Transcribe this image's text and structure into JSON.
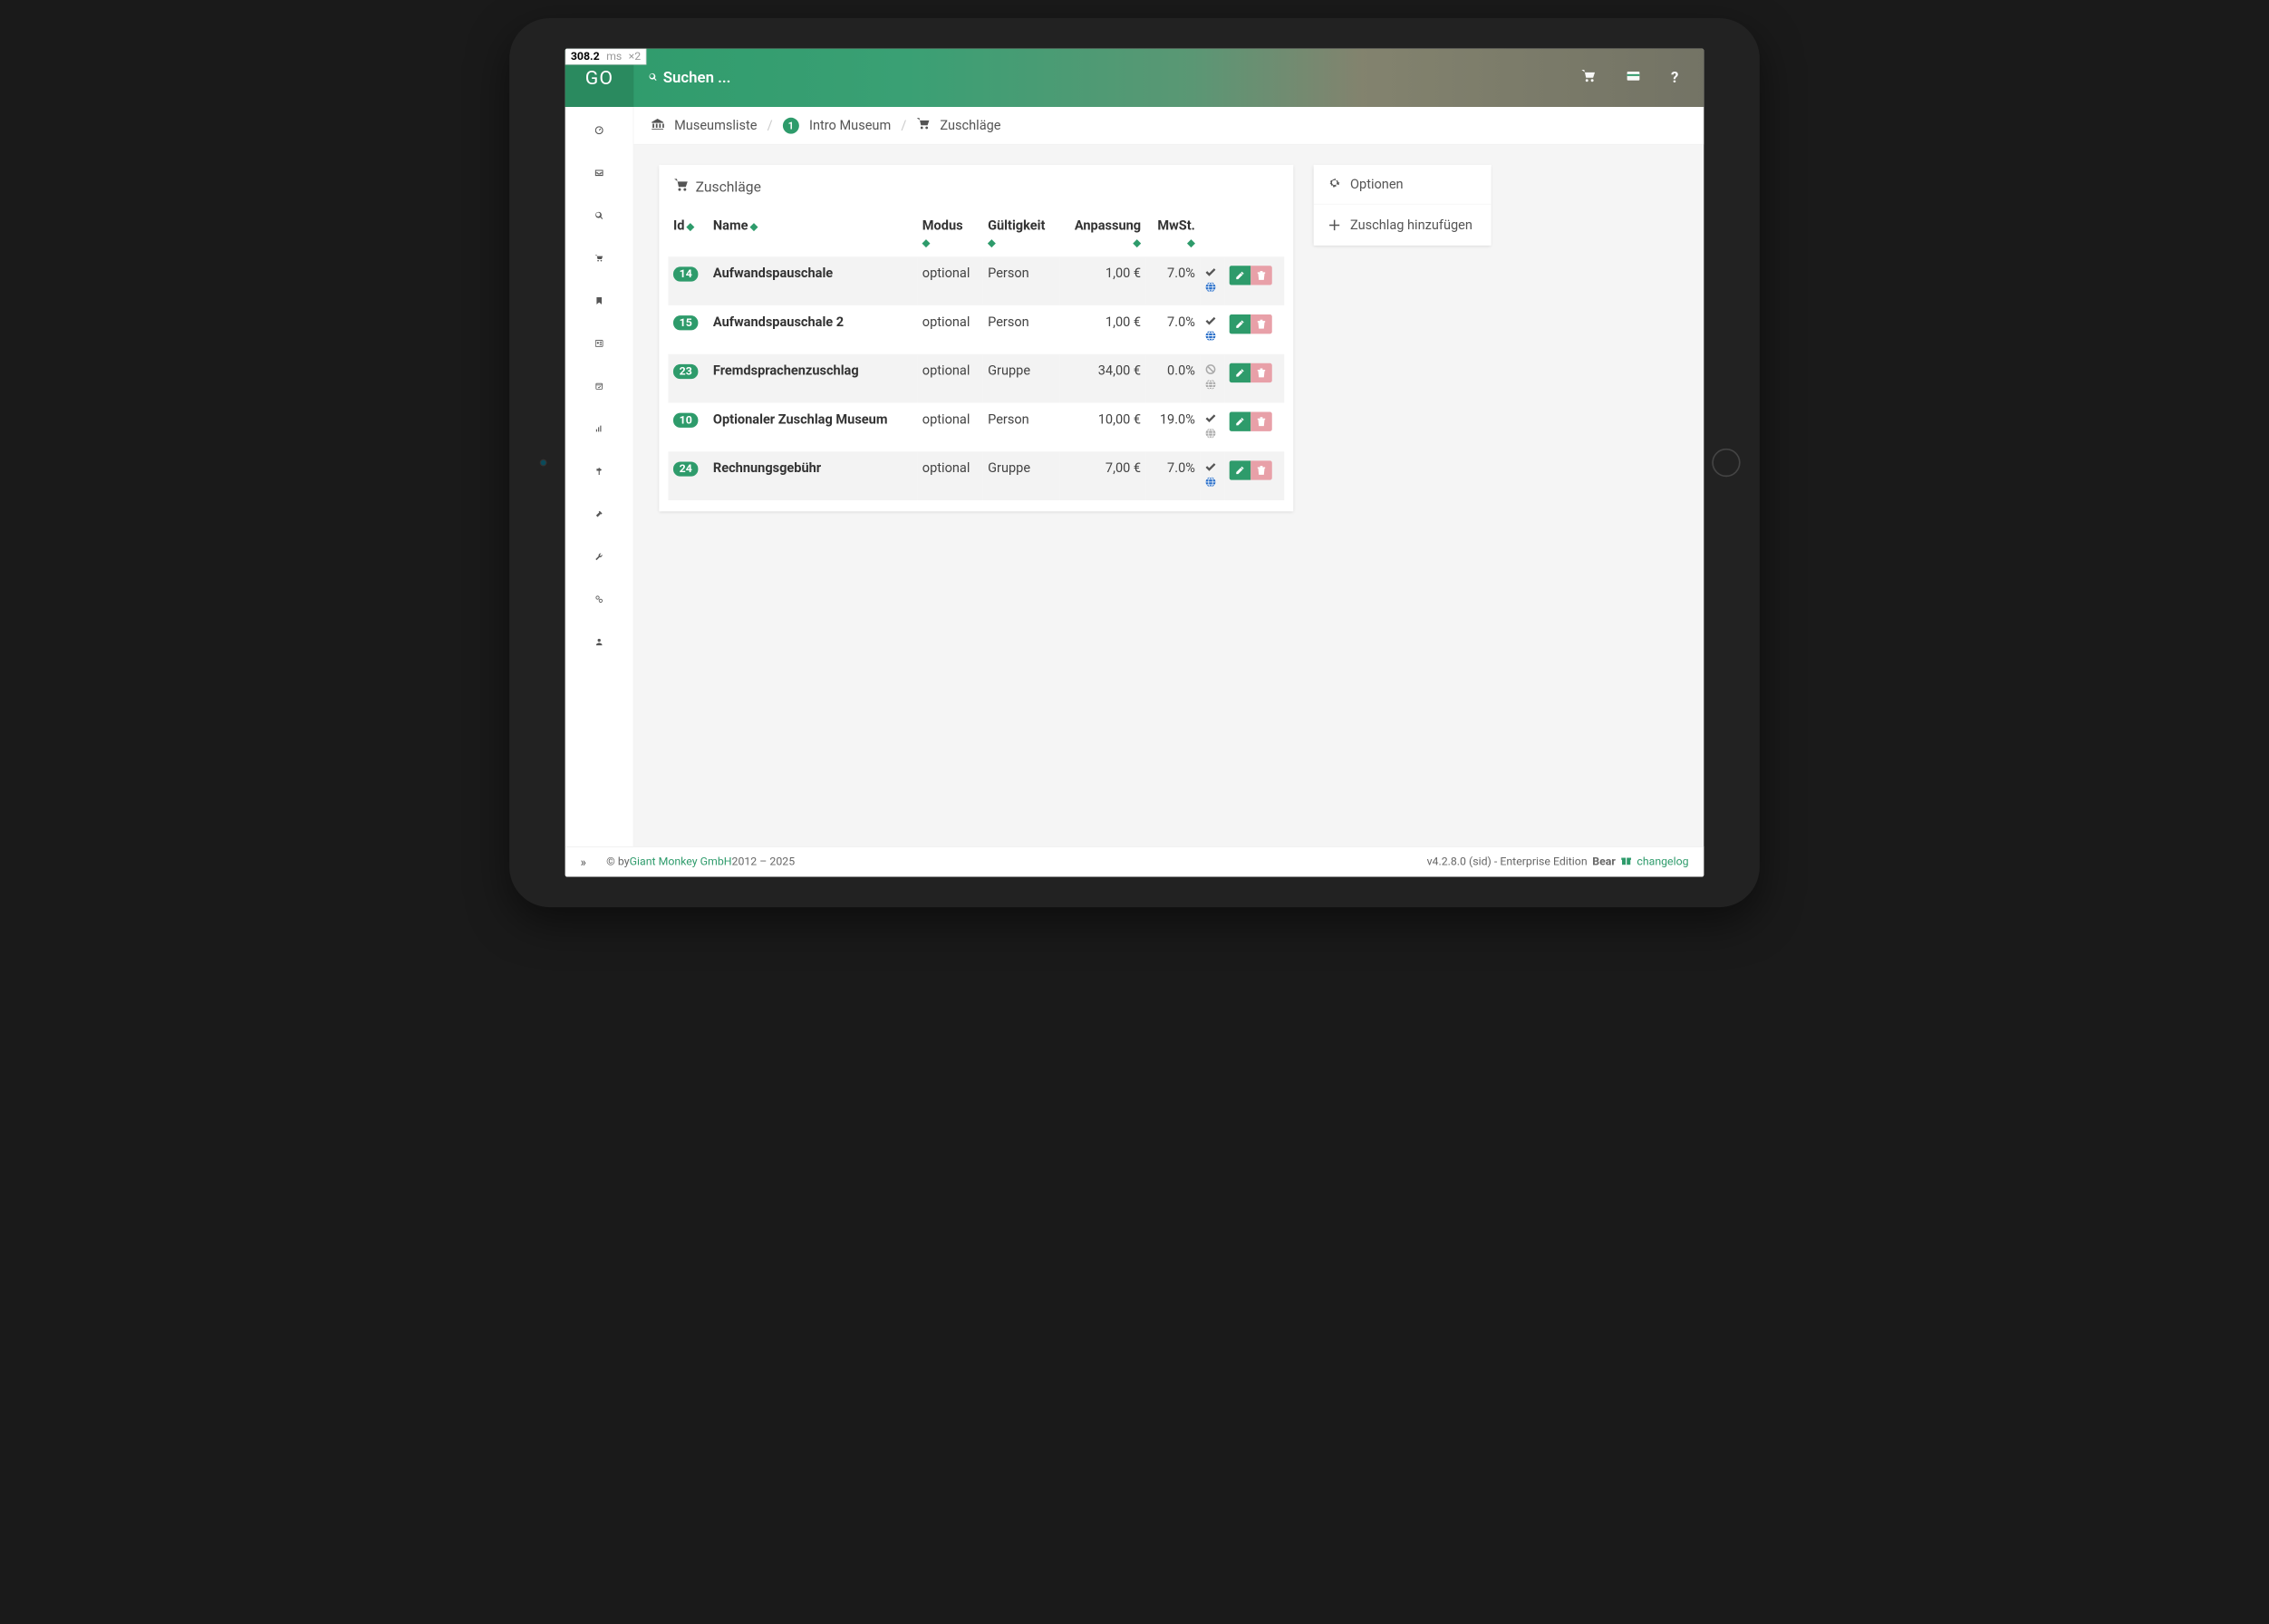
{
  "perf": {
    "time": "308.2",
    "unit": "ms",
    "mult": "×2"
  },
  "brand": "GO",
  "search": {
    "placeholder": "Suchen ..."
  },
  "breadcrumbs": {
    "b1": "Museumsliste",
    "b2_badge": "1",
    "b2": "Intro Museum",
    "b3": "Zuschläge"
  },
  "panel": {
    "title": "Zuschläge"
  },
  "options": {
    "title": "Optionen",
    "add": "Zuschlag hinzufügen"
  },
  "columns": {
    "id": "Id",
    "name": "Name",
    "modus": "Modus",
    "gueltigkeit": "Gültigkeit",
    "anpassung": "Anpassung",
    "mwst": "MwSt."
  },
  "rows": [
    {
      "id": "14",
      "name": "Aufwandspauschale",
      "modus": "optional",
      "gueltigkeit": "Person",
      "anpassung": "1,00 €",
      "mwst": "7.0%",
      "check": true,
      "globe_blue": true
    },
    {
      "id": "15",
      "name": "Aufwandspauschale 2",
      "modus": "optional",
      "gueltigkeit": "Person",
      "anpassung": "1,00 €",
      "mwst": "7.0%",
      "check": true,
      "globe_blue": true
    },
    {
      "id": "23",
      "name": "Fremdsprachenzuschlag",
      "modus": "optional",
      "gueltigkeit": "Gruppe",
      "anpassung": "34,00 €",
      "mwst": "0.0%",
      "ban": true,
      "globe_grey": true
    },
    {
      "id": "10",
      "name": "Optionaler Zuschlag Museum",
      "modus": "optional",
      "gueltigkeit": "Person",
      "anpassung": "10,00 €",
      "mwst": "19.0%",
      "check": true,
      "globe_grey": true
    },
    {
      "id": "24",
      "name": "Rechnungsgebühr",
      "modus": "optional",
      "gueltigkeit": "Gruppe",
      "anpassung": "7,00 €",
      "mwst": "7.0%",
      "check": true,
      "globe_blue": true
    }
  ],
  "footer": {
    "copy_pre": "© by ",
    "company": "Giant Monkey GmbH",
    "copy_post": " 2012 – 2025",
    "version": "v4.2.8.0 (sid) - Enterprise Edition ",
    "edition": "Bear",
    "changelog": "changelog"
  }
}
